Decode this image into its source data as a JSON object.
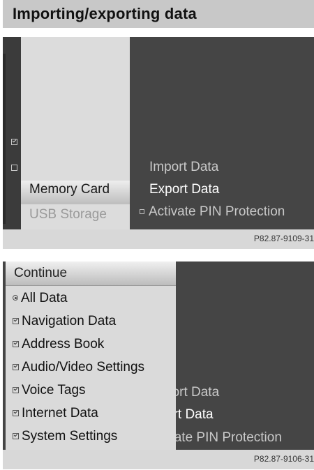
{
  "page": {
    "title": "Importing/exporting data"
  },
  "screen1": {
    "source_options": [
      {
        "label": "Memory Card",
        "state": "selected"
      },
      {
        "label": "USB Storage",
        "state": "disabled"
      }
    ],
    "actions": [
      {
        "label": "Import Data",
        "active": false
      },
      {
        "label": "Export Data",
        "active": true
      },
      {
        "label": "Activate PIN Protection",
        "active": false,
        "icon": "checkbox-empty-icon"
      }
    ],
    "side_icons": [
      "checkbox-checked-icon",
      "checkbox-empty-icon"
    ],
    "figure_code": "P82.87-9109-31"
  },
  "screen2": {
    "menu": {
      "header": "Continue",
      "items": [
        {
          "label": "All Data",
          "icon": "radio-selected-icon"
        },
        {
          "label": "Navigation Data",
          "icon": "checkbox-checked-icon"
        },
        {
          "label": "Address Book",
          "icon": "checkbox-checked-icon"
        },
        {
          "label": "Audio/Video Settings",
          "icon": "checkbox-checked-icon"
        },
        {
          "label": "Voice Tags",
          "icon": "checkbox-checked-icon"
        },
        {
          "label": "Internet Data",
          "icon": "checkbox-checked-icon"
        },
        {
          "label": "System Settings",
          "icon": "checkbox-checked-icon"
        }
      ]
    },
    "background_labels": [
      "port Data",
      "ort Data",
      "ivate PIN Protection"
    ],
    "figure_code": "P82.87-9106-31"
  },
  "colors": {
    "screen_bg": "#454545",
    "panel_bg": "#dcdcdc",
    "title_bar_bg": "#c8c8c8",
    "active_text": "#ffffff"
  }
}
